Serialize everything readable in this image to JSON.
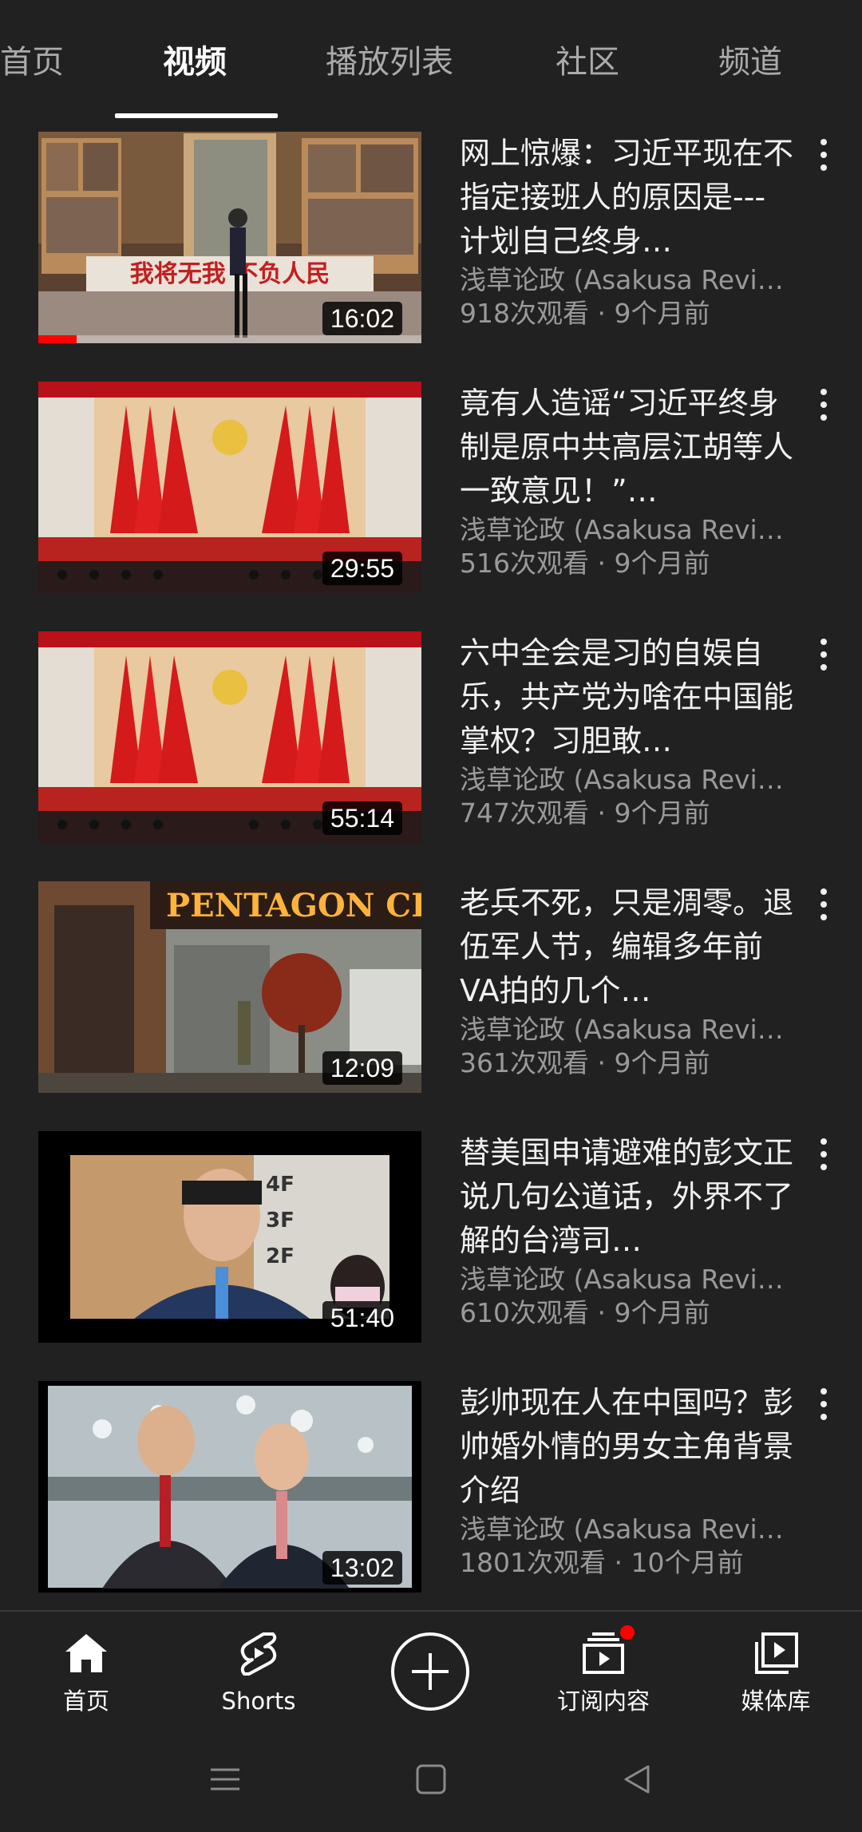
{
  "tabs": [
    {
      "label": "首页",
      "active": false
    },
    {
      "label": "视频",
      "active": true
    },
    {
      "label": "播放列表",
      "active": false
    },
    {
      "label": "社区",
      "active": false
    },
    {
      "label": "频道",
      "active": false
    }
  ],
  "videos": [
    {
      "title": "网上惊爆：习近平现在不指定接班人的原因是---计划自己终身…",
      "channel_views_age": "浅草论政 (Asakusa Revi…",
      "stats": "918次观看 · 9个月前",
      "duration": "16:02",
      "watched_fraction": 0.1,
      "thumb_banner": "我将无我 不负人民"
    },
    {
      "title": "竟有人造谣“习近平终身制是原中共高层江胡等人一致意见！”…",
      "channel_views_age": "浅草论政 (Asakusa Revi…",
      "stats": "516次观看 · 9个月前",
      "duration": "29:55"
    },
    {
      "title": "六中全会是习的自娱自乐，共产党为啥在中国能掌权？习胆敢…",
      "channel_views_age": "浅草论政 (Asakusa Revi…",
      "stats": "747次观看 · 9个月前",
      "duration": "55:14"
    },
    {
      "title": "老兵不死，只是凋零。退伍军人节，编辑多年前VA拍的几个…",
      "channel_views_age": "浅草论政 (Asakusa Revi…",
      "stats": "361次观看 · 9个月前",
      "duration": "12:09",
      "thumb_sign": "PENTAGON CI"
    },
    {
      "title": "替美国申请避难的彭文正说几句公道话，外界不了解的台湾司…",
      "channel_views_age": "浅草论政 (Asakusa Revi…",
      "stats": "610次观看 · 9个月前",
      "duration": "51:40",
      "thumb_floors": [
        "4F",
        "3F",
        "2F"
      ]
    },
    {
      "title": "彭帅现在人在中国吗？彭帅婚外情的男女主角背景介绍",
      "channel_views_age": "浅草论政 (Asakusa Revi…",
      "stats": "1801次观看 · 10个月前",
      "duration": "13:02"
    }
  ],
  "bottom_nav": {
    "home": "首页",
    "shorts": "Shorts",
    "subscriptions": "订阅内容",
    "library": "媒体库"
  },
  "colors": {
    "background": "#212121",
    "accent": "#ff0000",
    "secondary_text": "#9a9a9a"
  }
}
